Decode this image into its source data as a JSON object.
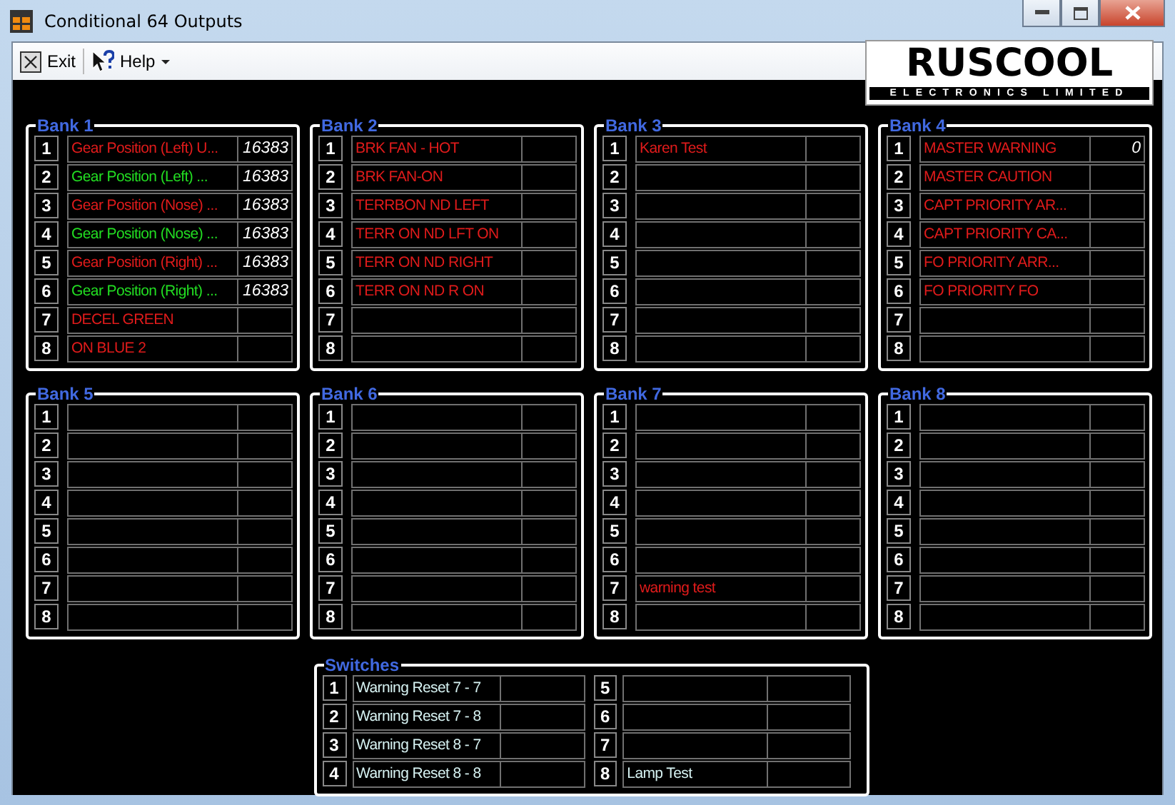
{
  "window": {
    "title": "Conditional 64 Outputs"
  },
  "menu": [
    {
      "kind": "exit",
      "label": "Exit"
    },
    {
      "kind": "help",
      "label": "Help"
    }
  ],
  "logo": {
    "name": "RUSCOOL",
    "tagline": "ELECTRONICS LIMITED"
  },
  "banks": [
    {
      "title": "Bank 1",
      "rows": [
        {
          "number": "1",
          "name": "Gear Position (Left) U...",
          "color": "#e01b1b",
          "value": "16383"
        },
        {
          "number": "2",
          "name": "Gear Position (Left) ...",
          "color": "#22dd22",
          "value": "16383"
        },
        {
          "number": "3",
          "name": "Gear Position (Nose) ...",
          "color": "#e01b1b",
          "value": "16383"
        },
        {
          "number": "4",
          "name": "Gear Position (Nose) ...",
          "color": "#22dd22",
          "value": "16383"
        },
        {
          "number": "5",
          "name": "Gear Position (Right) ...",
          "color": "#e01b1b",
          "value": "16383"
        },
        {
          "number": "6",
          "name": "Gear Position (Right) ...",
          "color": "#22dd22",
          "value": "16383"
        },
        {
          "number": "7",
          "name": "DECEL GREEN",
          "color": "#e01b1b"
        },
        {
          "number": "8",
          "name": "ON BLUE 2",
          "color": "#e01b1b"
        }
      ]
    },
    {
      "title": "Bank 2",
      "rows": [
        {
          "number": "1",
          "name": "BRK FAN - HOT",
          "color": "#e01b1b"
        },
        {
          "number": "2",
          "name": "BRK FAN-ON",
          "color": "#e01b1b"
        },
        {
          "number": "3",
          "name": "TERRBON ND LEFT",
          "color": "#e01b1b"
        },
        {
          "number": "4",
          "name": "TERR ON ND LFT ON",
          "color": "#e01b1b"
        },
        {
          "number": "5",
          "name": "TERR ON ND RIGHT",
          "color": "#e01b1b"
        },
        {
          "number": "6",
          "name": "TERR ON ND R ON",
          "color": "#e01b1b"
        },
        {
          "number": "7"
        },
        {
          "number": "8"
        }
      ]
    },
    {
      "title": "Bank 3",
      "rows": [
        {
          "number": "1",
          "name": "Karen Test",
          "color": "#e01b1b"
        },
        {
          "number": "2"
        },
        {
          "number": "3"
        },
        {
          "number": "4"
        },
        {
          "number": "5"
        },
        {
          "number": "6"
        },
        {
          "number": "7"
        },
        {
          "number": "8"
        }
      ]
    },
    {
      "title": "Bank 4",
      "rows": [
        {
          "number": "1",
          "name": "MASTER WARNING",
          "color": "#e01b1b",
          "value": "0"
        },
        {
          "number": "2",
          "name": "MASTER CAUTION",
          "color": "#e01b1b"
        },
        {
          "number": "3",
          "name": "CAPT PRIORITY AR...",
          "color": "#e01b1b"
        },
        {
          "number": "4",
          "name": "CAPT PRIORITY CA...",
          "color": "#e01b1b"
        },
        {
          "number": "5",
          "name": "FO PRIORITY ARR...",
          "color": "#e01b1b"
        },
        {
          "number": "6",
          "name": "FO PRIORITY FO",
          "color": "#e01b1b"
        },
        {
          "number": "7"
        },
        {
          "number": "8"
        }
      ]
    },
    {
      "title": "Bank 5",
      "rows": [
        {
          "number": "1"
        },
        {
          "number": "2"
        },
        {
          "number": "3"
        },
        {
          "number": "4"
        },
        {
          "number": "5"
        },
        {
          "number": "6"
        },
        {
          "number": "7"
        },
        {
          "number": "8"
        }
      ]
    },
    {
      "title": "Bank 6",
      "rows": [
        {
          "number": "1"
        },
        {
          "number": "2"
        },
        {
          "number": "3"
        },
        {
          "number": "4"
        },
        {
          "number": "5"
        },
        {
          "number": "6"
        },
        {
          "number": "7"
        },
        {
          "number": "8"
        }
      ]
    },
    {
      "title": "Bank 7",
      "rows": [
        {
          "number": "1"
        },
        {
          "number": "2"
        },
        {
          "number": "3"
        },
        {
          "number": "4"
        },
        {
          "number": "5"
        },
        {
          "number": "6"
        },
        {
          "number": "7",
          "name": "warning test",
          "color": "#e01b1b"
        },
        {
          "number": "8"
        }
      ]
    },
    {
      "title": "Bank 8",
      "rows": [
        {
          "number": "1"
        },
        {
          "number": "2"
        },
        {
          "number": "3"
        },
        {
          "number": "4"
        },
        {
          "number": "5"
        },
        {
          "number": "6"
        },
        {
          "number": "7"
        },
        {
          "number": "8"
        }
      ]
    }
  ],
  "switches": {
    "title": "Switches",
    "rows": [
      {
        "number": "1",
        "name": "Warning Reset 7 - 7"
      },
      {
        "number": "2",
        "name": "Warning Reset 7 - 8"
      },
      {
        "number": "3",
        "name": "Warning Reset 8 - 7"
      },
      {
        "number": "4",
        "name": "Warning Reset 8 - 8"
      },
      {
        "number": "5"
      },
      {
        "number": "6"
      },
      {
        "number": "7"
      },
      {
        "number": "8",
        "name": "Lamp Test"
      }
    ]
  }
}
